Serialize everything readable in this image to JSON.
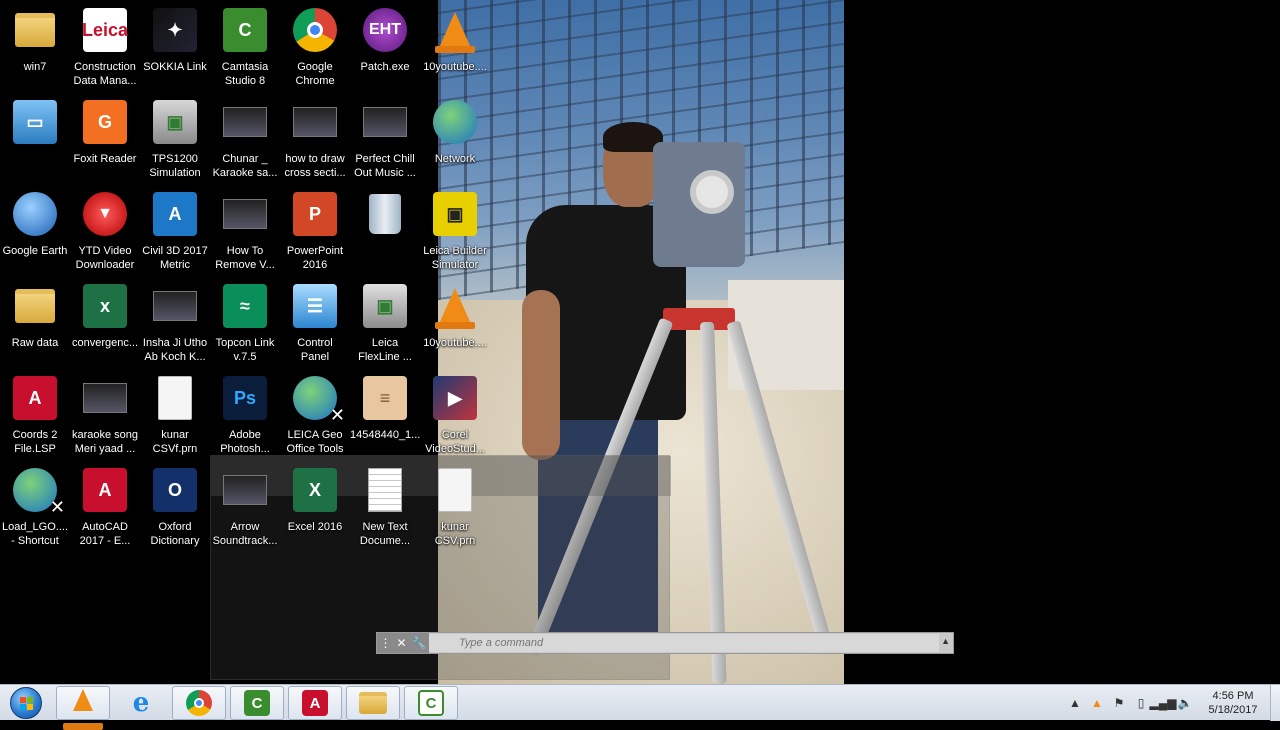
{
  "desktop": {
    "icons": [
      {
        "label": "win7",
        "icon": "user-folder-icon"
      },
      {
        "label": "Construction\nData Mana...",
        "icon": "leica-logo-icon"
      },
      {
        "label": "SOKKIA Link",
        "icon": "sokkia-link-icon"
      },
      {
        "label": "Camtasia\nStudio 8",
        "icon": "camtasia-icon"
      },
      {
        "label": "Google\nChrome",
        "icon": "chrome-icon"
      },
      {
        "label": "Patch.exe",
        "icon": "patch-icon"
      },
      {
        "label": "10youtube....",
        "icon": "vlc-cone-icon"
      },
      {
        "label": "",
        "icon": "computer-icon"
      },
      {
        "label": "Foxit Reader",
        "icon": "foxit-pdf-icon"
      },
      {
        "label": "TPS1200\nSimulation",
        "icon": "tps1200-icon"
      },
      {
        "label": "Chunar _\nKaraoke sa...",
        "icon": "video-file-icon"
      },
      {
        "label": "how to draw\ncross secti...",
        "icon": "video-file-icon"
      },
      {
        "label": "Perfect Chill\nOut Music ...",
        "icon": "video-file-icon"
      },
      {
        "label": "Network",
        "icon": "network-globe-icon"
      },
      {
        "label": "Google Earth",
        "icon": "google-earth-icon"
      },
      {
        "label": "YTD Video\nDownloader",
        "icon": "ytd-icon"
      },
      {
        "label": "Civil 3D 2017\nMetric",
        "icon": "civil3d-icon"
      },
      {
        "label": "How To\nRemove V...",
        "icon": "video-file-icon"
      },
      {
        "label": "PowerPoint\n2016",
        "icon": "powerpoint-icon"
      },
      {
        "label": "",
        "icon": "recycle-bin-icon"
      },
      {
        "label": "Leica Builder\nSimulator",
        "icon": "leica-builder-icon"
      },
      {
        "label": "Raw data",
        "icon": "folder-icon"
      },
      {
        "label": "convergenc...",
        "icon": "excel-file-icon"
      },
      {
        "label": "Insha Ji Utho\nAb Koch K...",
        "icon": "video-file-icon"
      },
      {
        "label": "Topcon Link\nv.7.5",
        "icon": "topcon-link-icon"
      },
      {
        "label": "Control\nPanel",
        "icon": "control-panel-icon"
      },
      {
        "label": "Leica\nFlexLine ...",
        "icon": "leica-flexline-icon"
      },
      {
        "label": "10youtube....",
        "icon": "vlc-cone-icon"
      },
      {
        "label": "Coords 2\nFile.LSP",
        "icon": "autocad-lsp-icon"
      },
      {
        "label": "karaoke song\nMeri yaad ...",
        "icon": "video-file-icon"
      },
      {
        "label": "kunar\nCSVf.prn",
        "icon": "blank-file-icon"
      },
      {
        "label": "Adobe\nPhotosh...",
        "icon": "photoshop-icon"
      },
      {
        "label": "LEICA Geo\nOffice Tools",
        "icon": "leica-geo-office-icon"
      },
      {
        "label": "14548440_1...",
        "icon": "image-file-icon"
      },
      {
        "label": "Corel\nVideoStud...",
        "icon": "corel-videostudio-icon"
      },
      {
        "label": "Load_LGO....\n- Shortcut",
        "icon": "network-globe-icon"
      },
      {
        "label": "AutoCAD\n2017 - E...",
        "icon": "autocad-icon"
      },
      {
        "label": "Oxford\nDictionary",
        "icon": "oxford-dictionary-icon"
      },
      {
        "label": "Arrow\nSoundtrack...",
        "icon": "video-file-icon"
      },
      {
        "label": "Excel 2016",
        "icon": "excel-icon"
      },
      {
        "label": "New Text\nDocume...",
        "icon": "text-document-icon"
      },
      {
        "label": "kunar\nCSV.prn",
        "icon": "blank-file-icon"
      }
    ]
  },
  "command_line": {
    "placeholder": "Type a command"
  },
  "taskbar": {
    "pinned": [
      {
        "name": "vlc",
        "icon": "vlc-cone-icon"
      },
      {
        "name": "internet-explorer",
        "icon": "ie-icon"
      },
      {
        "name": "chrome",
        "icon": "chrome-icon"
      },
      {
        "name": "camtasia",
        "icon": "camtasia-icon"
      },
      {
        "name": "autocad",
        "icon": "autocad-icon"
      },
      {
        "name": "windows-explorer",
        "icon": "folder-icon"
      },
      {
        "name": "camtasia-recorder",
        "icon": "camtasia-icon"
      }
    ],
    "clock": {
      "time": "4:56 PM",
      "date": "5/18/2017"
    }
  },
  "colors": {
    "desktop_bg": "#000000",
    "taskbar_bg": "#dfe6ee",
    "accent_blue": "#2a7cd0"
  }
}
